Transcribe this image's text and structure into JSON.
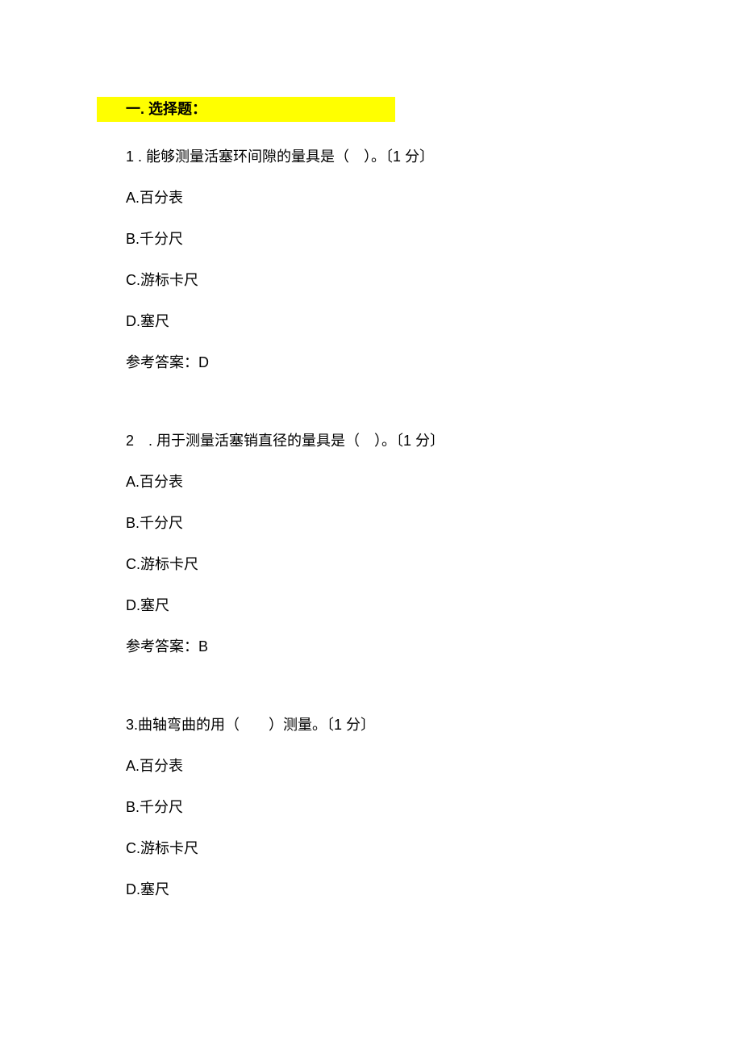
{
  "section_header": "一. 选择题：",
  "questions": [
    {
      "text": "1  . 能够测量活塞环间隙的量具是（　）。〔1 分〕",
      "options": [
        "A.百分表",
        "B.千分尺",
        "C.游标卡尺",
        "D.塞尺"
      ],
      "answer": "参考答案：D"
    },
    {
      "text": "2　. 用于测量活塞销直径的量具是（　）。〔1 分〕",
      "options": [
        "A.百分表",
        "B.千分尺",
        "C.游标卡尺",
        "D.塞尺"
      ],
      "answer": "参考答案：B"
    },
    {
      "text": "3.曲轴弯曲的用（　　）测量。〔1 分〕",
      "options": [
        "A.百分表",
        "B.千分尺",
        "C.游标卡尺",
        "D.塞尺"
      ],
      "answer": ""
    }
  ]
}
